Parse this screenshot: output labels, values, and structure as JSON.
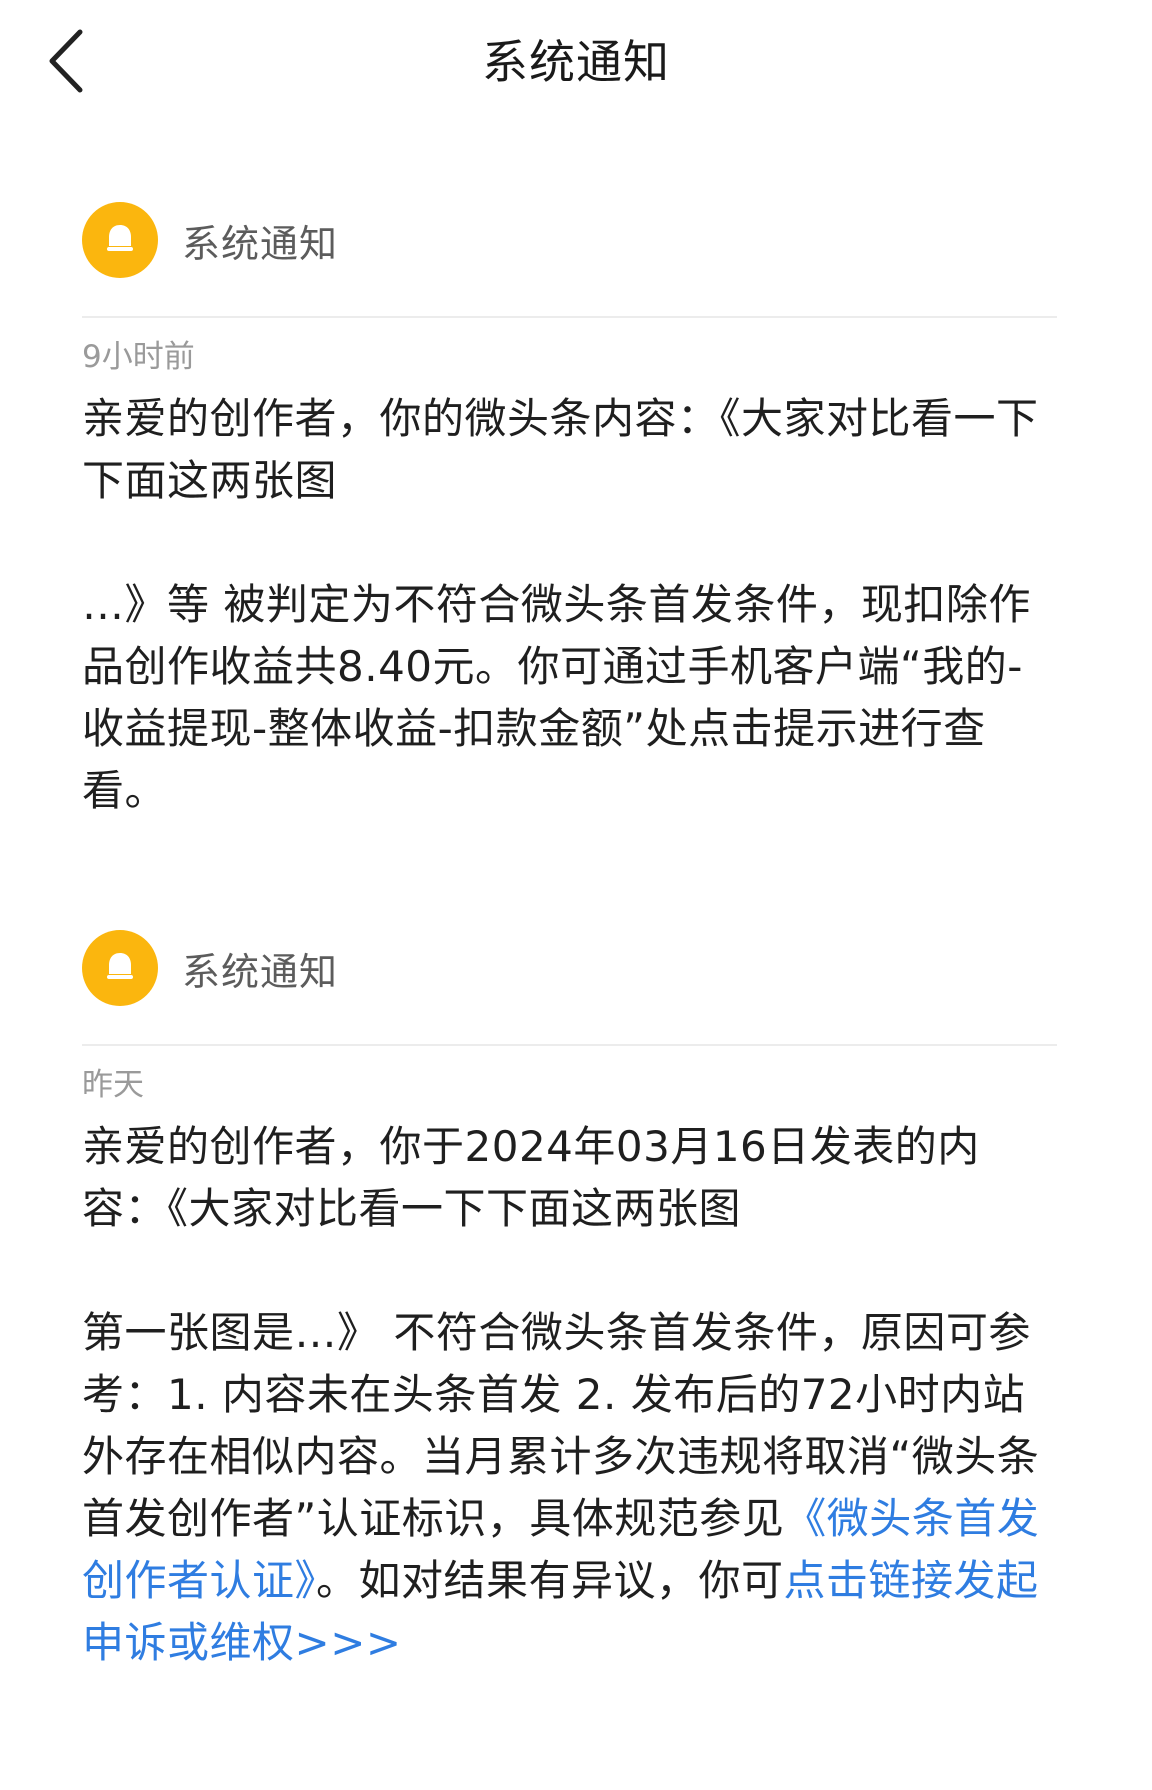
{
  "header": {
    "title": "系统通知"
  },
  "notices": [
    {
      "sender": "系统通知",
      "time": "9小时前",
      "para1": "亲爱的创作者，你的微头条内容：《大家对比看一下下面这两张图",
      "para2": "…》等 被判定为不符合微头条首发条件，现扣除作品创作收益共8.40元。你可通过手机客户端“我的-收益提现-整体收益-扣款金额”处点击提示进行查看。"
    },
    {
      "sender": "系统通知",
      "time": "昨天",
      "para1": "亲爱的创作者，你于2024年03月16日发表的内容：《大家对比看一下下面这两张图",
      "para2_before_link1": "第一张图是…》 不符合微头条首发条件，原因可参考：1. 内容未在头条首发 2. 发布后的72小时内站外存在相似内容。当月累计多次违规将取消“微头条首发创作者”认证标识，具体规范参见",
      "link1": "《微头条首发创作者认证》",
      "para2_between_links": "。如对结果有异议，你可",
      "link2": "点击链接发起申诉或维权>>>"
    }
  ],
  "colors": {
    "accent_avatar": "#fbb60e",
    "link": "#2f7de1",
    "time_text": "#9a9a9a",
    "sender_text": "#5c5c5c"
  },
  "icons": {
    "back": "chevron-left-icon",
    "avatar": "bell-icon"
  }
}
